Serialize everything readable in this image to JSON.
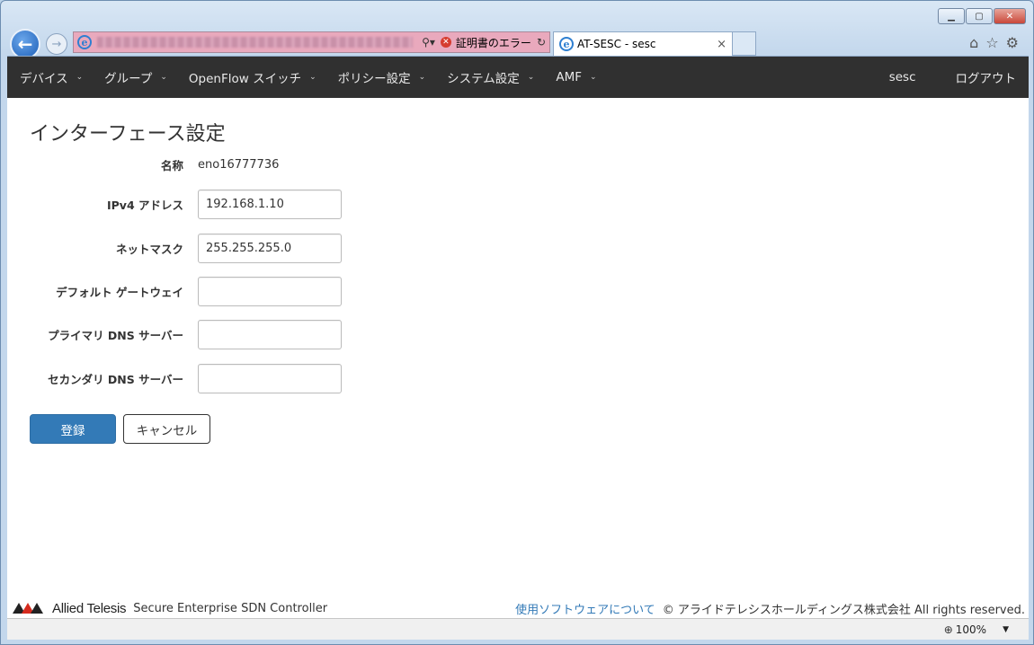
{
  "browser": {
    "cert_error": "証明書のエラー",
    "tab_title": "AT-SESC - sesc",
    "tab_close": "×",
    "zoom": "100%"
  },
  "nav": {
    "items": [
      {
        "label": "デバイス"
      },
      {
        "label": "グループ"
      },
      {
        "label": "OpenFlow スイッチ"
      },
      {
        "label": "ポリシー設定"
      },
      {
        "label": "システム設定"
      },
      {
        "label": "AMF"
      }
    ],
    "user": "sesc",
    "logout": "ログアウト"
  },
  "page": {
    "title": "インターフェース設定",
    "fields": {
      "name": {
        "label": "名称",
        "value": "eno16777736"
      },
      "ipv4": {
        "label": "IPv4 アドレス",
        "value": "192.168.1.10"
      },
      "netmask": {
        "label": "ネットマスク",
        "value": "255.255.255.0"
      },
      "gateway": {
        "label": "デフォルト ゲートウェイ",
        "value": ""
      },
      "dns1": {
        "label": "プライマリ DNS サーバー",
        "value": ""
      },
      "dns2": {
        "label": "セカンダリ DNS サーバー",
        "value": ""
      }
    },
    "submit": "登録",
    "cancel": "キャンセル"
  },
  "footer": {
    "brand": "Allied Telesis",
    "product": "Secure Enterprise SDN Controller",
    "software_link": "使用ソフトウェアについて",
    "copyright": "© アライドテレシスホールディングス株式会社 All rights reserved."
  },
  "colors": {
    "navbar_bg": "#303030",
    "primary": "#337ab7",
    "link": "#337ab7",
    "logo_red": "#d52b1e",
    "cert_error": "#d63c2f"
  }
}
